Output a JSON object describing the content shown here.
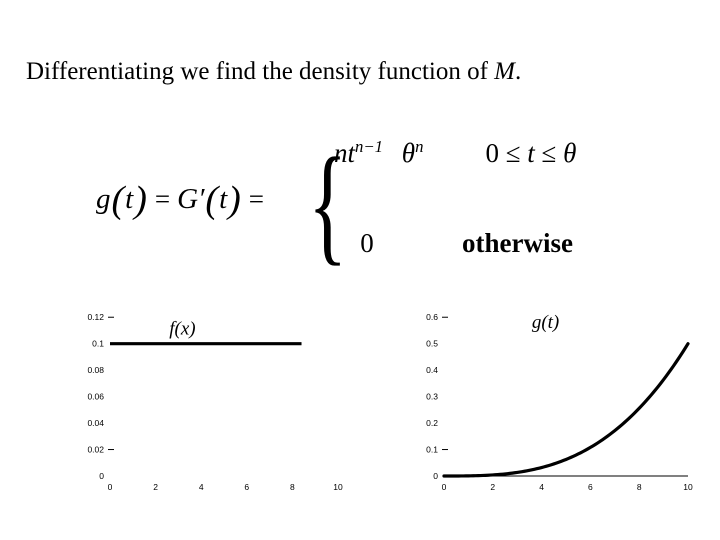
{
  "slide": {
    "title_prefix": "Differentiating we find the density function of ",
    "title_variable": "M",
    "title_suffix": "."
  },
  "formula": {
    "lhs_g": "g",
    "lhs_t1": "t",
    "equals_1": "=",
    "lhs_G": "G",
    "prime": "′",
    "lhs_t2": "t",
    "equals_2": "=",
    "brace": "{",
    "case1_numerator_n": "nt",
    "case1_numerator_exp": "n−1",
    "case1_denominator_theta": "θ",
    "case1_denominator_exp": "n",
    "case1_condition": "0 ≤ t ≤ θ",
    "case1_condition_zero": "0",
    "case1_condition_le1": "≤",
    "case1_condition_var": "t",
    "case1_condition_le2": "≤",
    "case1_condition_theta": "θ",
    "case2_value": "0",
    "case2_condition": "otherwise",
    "paren_open": "(",
    "paren_close": ")"
  },
  "chart_data": [
    {
      "id": "chart-left",
      "type": "line",
      "title": "f(x)",
      "label": "f(x)",
      "xlabel": "",
      "ylabel": "",
      "xlim": [
        0,
        10
      ],
      "ylim": [
        0,
        0.13
      ],
      "grid": false,
      "legend": "none",
      "x_ticks": [
        "0",
        "2",
        "4",
        "6",
        "8",
        "10"
      ],
      "x_tick_values": [
        0,
        2,
        4,
        6,
        8,
        10
      ],
      "y_ticks": [
        "0",
        "0.02",
        "0.04",
        "0.06",
        "0.08",
        "0.1",
        "0.12"
      ],
      "y_tick_values": [
        0,
        0.02,
        0.04,
        0.06,
        0.08,
        0.1,
        0.12
      ],
      "series": [
        {
          "name": "f(x)",
          "x": [
            0,
            1,
            2,
            3,
            4,
            5,
            6,
            7,
            8,
            8.4
          ],
          "values": [
            0.1,
            0.1,
            0.1,
            0.1,
            0.1,
            0.1,
            0.1,
            0.1,
            0.1,
            0.1
          ],
          "color": "#000000"
        }
      ]
    },
    {
      "id": "chart-right",
      "type": "line",
      "title": "g(t)",
      "label": "g(t)",
      "xlabel": "",
      "ylabel": "",
      "xlim": [
        0,
        10
      ],
      "ylim": [
        0,
        0.65
      ],
      "grid": false,
      "legend": "none",
      "x_ticks": [
        "0",
        "2",
        "4",
        "6",
        "8",
        "10"
      ],
      "x_tick_values": [
        0,
        2,
        4,
        6,
        8,
        10
      ],
      "y_ticks": [
        "0",
        "0.1",
        "0.2",
        "0.3",
        "0.4",
        "0.5",
        "0.6"
      ],
      "y_tick_values": [
        0,
        0.1,
        0.2,
        0.3,
        0.4,
        0.5,
        0.6
      ],
      "series": [
        {
          "name": "g(t)",
          "x": [
            0,
            1,
            2,
            3,
            4,
            5,
            6,
            7,
            8,
            9,
            10
          ],
          "values": [
            0,
            0.0005,
            0.004,
            0.0135,
            0.032,
            0.0625,
            0.108,
            0.1715,
            0.256,
            0.3645,
            0.5
          ],
          "color": "#000000"
        }
      ]
    }
  ]
}
